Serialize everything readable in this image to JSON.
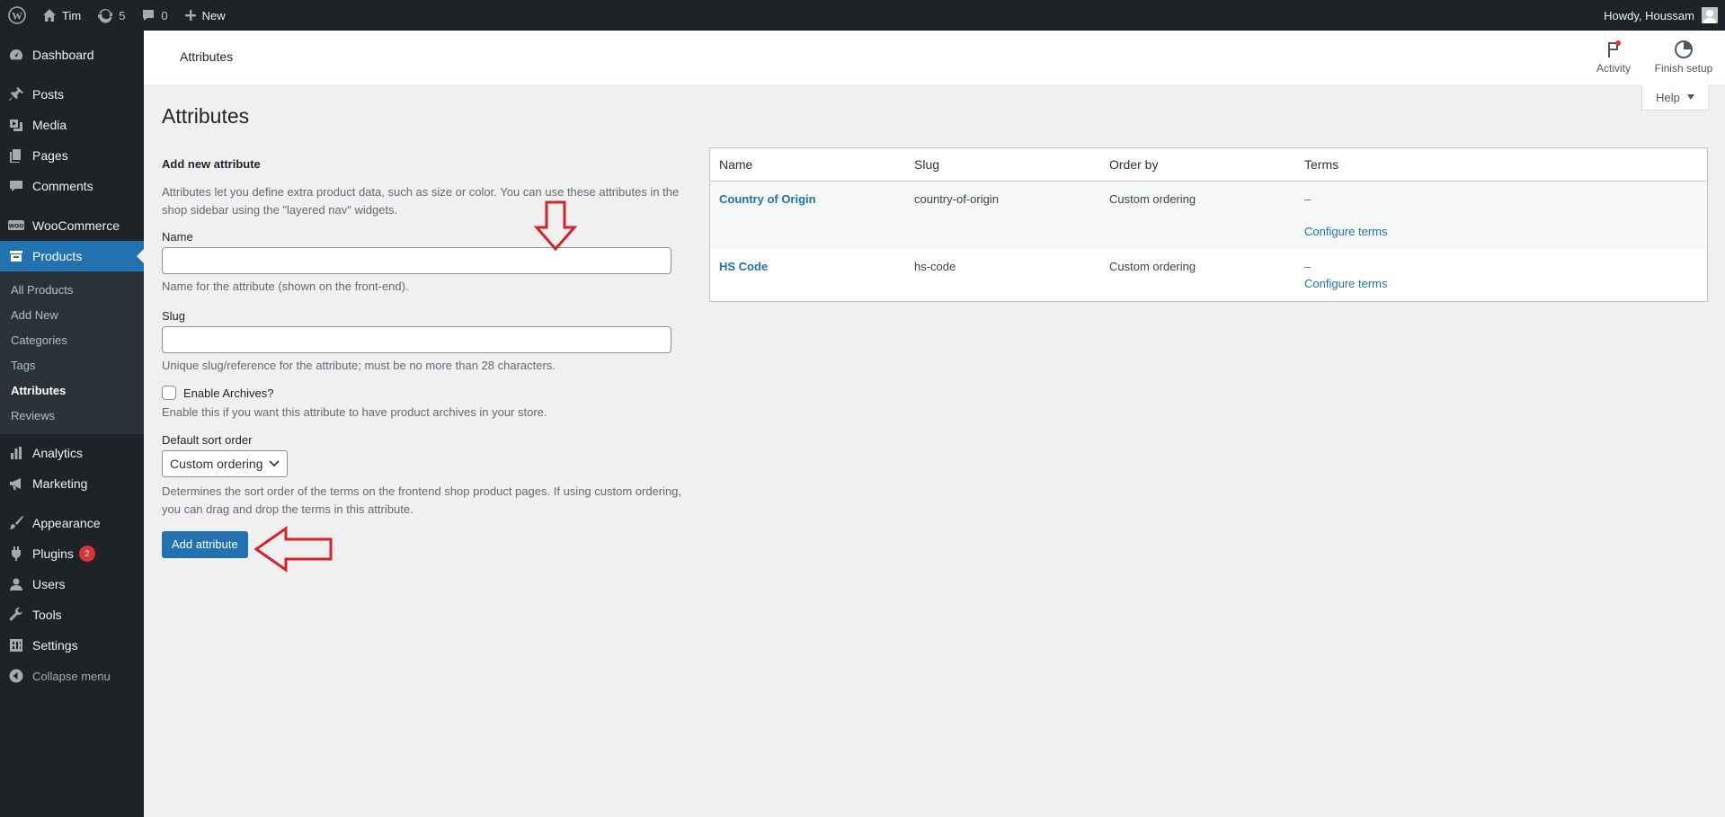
{
  "adminbar": {
    "site_name": "Tim",
    "updates_count": "5",
    "comments_count": "0",
    "new_label": "New",
    "greeting": "Howdy, Houssam"
  },
  "sidebar": {
    "items": [
      {
        "label": "Dashboard",
        "icon": "dashboard-icon"
      },
      {
        "label": "Posts",
        "icon": "pin-icon"
      },
      {
        "label": "Media",
        "icon": "media-icon"
      },
      {
        "label": "Pages",
        "icon": "pages-icon"
      },
      {
        "label": "Comments",
        "icon": "comment-icon"
      },
      {
        "label": "WooCommerce",
        "icon": "woo-icon"
      },
      {
        "label": "Products",
        "icon": "archive-icon"
      },
      {
        "label": "Analytics",
        "icon": "chart-icon"
      },
      {
        "label": "Marketing",
        "icon": "megaphone-icon"
      },
      {
        "label": "Appearance",
        "icon": "brush-icon"
      },
      {
        "label": "Plugins",
        "icon": "plug-icon",
        "badge": "2"
      },
      {
        "label": "Users",
        "icon": "user-icon"
      },
      {
        "label": "Tools",
        "icon": "wrench-icon"
      },
      {
        "label": "Settings",
        "icon": "settings-icon"
      }
    ],
    "submenu": [
      "All Products",
      "Add New",
      "Categories",
      "Tags",
      "Attributes",
      "Reviews"
    ],
    "collapse_label": "Collapse menu"
  },
  "header": {
    "title": "Attributes",
    "activity_label": "Activity",
    "finish_setup_label": "Finish setup",
    "help_label": "Help"
  },
  "page_title": "Attributes",
  "form": {
    "section_title": "Add new attribute",
    "intro": "Attributes let you define extra product data, such as size or color. You can use these attributes in the shop sidebar using the \"layered nav\" widgets.",
    "name_label": "Name",
    "name_value": "",
    "name_desc": "Name for the attribute (shown on the front-end).",
    "slug_label": "Slug",
    "slug_value": "",
    "slug_desc": "Unique slug/reference for the attribute; must be no more than 28 characters.",
    "archives_label": "Enable Archives?",
    "archives_desc": "Enable this if you want this attribute to have product archives in your store.",
    "sort_label": "Default sort order",
    "sort_value": "Custom ordering",
    "sort_desc": "Determines the sort order of the terms on the frontend shop product pages. If using custom ordering, you can drag and drop the terms in this attribute.",
    "submit_label": "Add attribute"
  },
  "table": {
    "headers": [
      "Name",
      "Slug",
      "Order by",
      "Terms"
    ],
    "rows": [
      {
        "name": "Country of Origin",
        "slug": "country-of-origin",
        "order_by": "Custom ordering",
        "terms": "–",
        "action": "Configure terms"
      },
      {
        "name": "HS Code",
        "slug": "hs-code",
        "order_by": "Custom ordering",
        "terms": "–",
        "action": "Configure terms"
      }
    ]
  },
  "colors": {
    "admin_dark": "#1d2327",
    "accent_blue": "#2271b1",
    "annotation_red": "#d6222a"
  }
}
